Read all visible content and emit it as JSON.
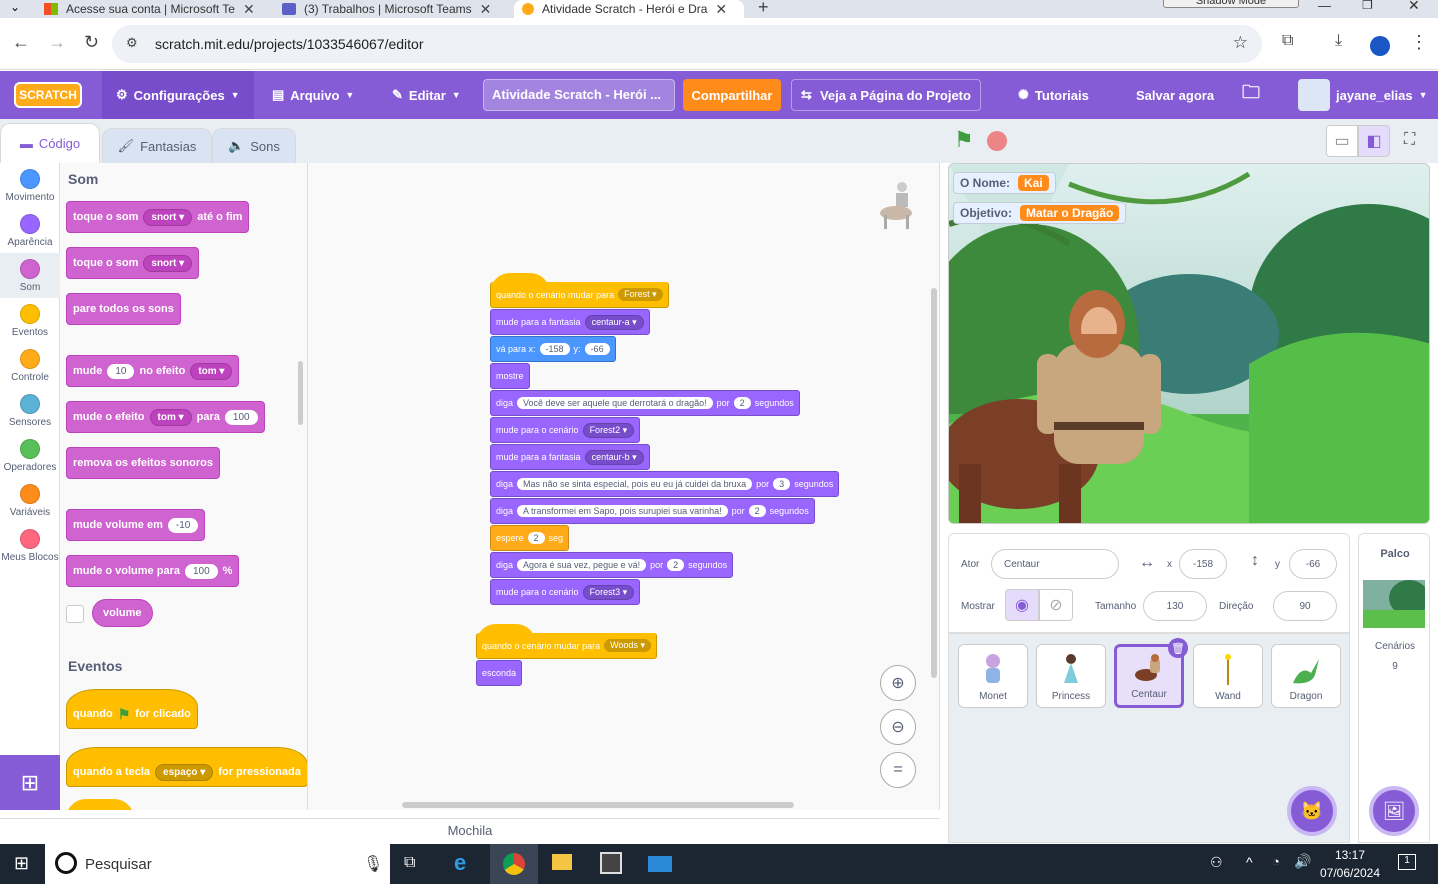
{
  "browser": {
    "tabs": [
      {
        "label": "Acesse sua conta | Microsoft Te"
      },
      {
        "label": "(3) Trabalhos | Microsoft Teams"
      },
      {
        "label": "Atividade Scratch - Herói e Dra"
      }
    ],
    "shadow_mode": "Shadow Mode",
    "url": "scratch.mit.edu/projects/1033546067/editor"
  },
  "menu": {
    "logo": "SCRATCH",
    "settings": "Configurações",
    "file": "Arquivo",
    "edit": "Editar",
    "project_title": "Atividade Scratch - Herói ...",
    "share": "Compartilhar",
    "project_page": "Veja a Página do Projeto",
    "tutorials": "Tutoriais",
    "save_now": "Salvar agora",
    "username": "jayane_elias"
  },
  "editor_tabs": {
    "code": "Código",
    "costumes": "Fantasias",
    "sounds": "Sons"
  },
  "categories": [
    {
      "label": "Movimento",
      "color": "#4c97ff"
    },
    {
      "label": "Aparência",
      "color": "#9966ff"
    },
    {
      "label": "Som",
      "color": "#cf63cf"
    },
    {
      "label": "Eventos",
      "color": "#ffbf00"
    },
    {
      "label": "Controle",
      "color": "#ffab19"
    },
    {
      "label": "Sensores",
      "color": "#5cb1d6"
    },
    {
      "label": "Operadores",
      "color": "#59c059"
    },
    {
      "label": "Variáveis",
      "color": "#ff8c1a"
    },
    {
      "label": "Meus Blocos",
      "color": "#ff6680"
    }
  ],
  "palette": {
    "sound_heading": "Som",
    "play_until_done": {
      "a": "toque o som",
      "dd": "snort",
      "b": "até o fim"
    },
    "start_sound": {
      "a": "toque o som",
      "dd": "snort"
    },
    "stop_all": "pare todos os sons",
    "change_effect": {
      "a": "mude",
      "val": "10",
      "b": "no efeito",
      "dd": "tom"
    },
    "set_effect": {
      "a": "mude o efeito",
      "dd": "tom",
      "b": "para",
      "val": "100"
    },
    "clear_effects": "remova os efeitos sonoros",
    "change_volume": {
      "a": "mude volume em",
      "val": "-10"
    },
    "set_volume": {
      "a": "mude o volume para",
      "val": "100",
      "b": "%"
    },
    "volume": "volume",
    "events_heading": "Eventos",
    "when_flag": {
      "a": "quando",
      "b": "for clicado"
    },
    "when_key": {
      "a": "quando a tecla",
      "dd": "espaço",
      "b": "for pressionada"
    }
  },
  "script1": {
    "hat": {
      "a": "quando o cenário mudar para",
      "dd": "Forest"
    },
    "b1": {
      "a": "mude para a fantasia",
      "dd": "centaur-a"
    },
    "b2": {
      "a": "vá para x:",
      "x": "-158",
      "b": "y:",
      "y": "-66"
    },
    "b3": "mostre",
    "b4": {
      "a": "diga",
      "text": "Você deve ser aquele que derrotará o dragão!",
      "b": "por",
      "n": "2",
      "c": "segundos"
    },
    "b5": {
      "a": "mude para o cenário",
      "dd": "Forest2"
    },
    "b6": {
      "a": "mude para a fantasia",
      "dd": "centaur-b"
    },
    "b7": {
      "a": "diga",
      "text": "Mas não se sinta especial, pois eu eu já cuidei da bruxa",
      "b": "por",
      "n": "3",
      "c": "segundos"
    },
    "b8": {
      "a": "diga",
      "text": "A transformei em Sapo, pois surupiei sua varinha!",
      "b": "por",
      "n": "2",
      "c": "segundos"
    },
    "b9": {
      "a": "espere",
      "n": "2",
      "b": "seg"
    },
    "b10": {
      "a": "diga",
      "text": "Agora é sua vez, pegue e vá!",
      "b": "por",
      "n": "2",
      "c": "segundos"
    },
    "b11": {
      "a": "mude para o cenário",
      "dd": "Forest3"
    }
  },
  "script2": {
    "hat": {
      "a": "quando o cenário mudar para",
      "dd": "Woods"
    },
    "b1": "esconda"
  },
  "backpack": "Mochila",
  "stage": {
    "monitor1": {
      "label": "O Nome:",
      "value": "Kai"
    },
    "monitor2": {
      "label": "Objetivo:",
      "value": "Matar o Dragão"
    }
  },
  "sprite_info": {
    "sprite_label": "Ator",
    "sprite_name": "Centaur",
    "x_label": "x",
    "x": "-158",
    "y_label": "y",
    "y": "-66",
    "show_label": "Mostrar",
    "size_label": "Tamanho",
    "size": "130",
    "direction_label": "Direção",
    "direction": "90"
  },
  "sprites": [
    {
      "name": "Monet"
    },
    {
      "name": "Princess"
    },
    {
      "name": "Centaur"
    },
    {
      "name": "Wand"
    },
    {
      "name": "Dragon"
    }
  ],
  "stage_panel": {
    "title": "Palco",
    "backdrops_label": "Cenários",
    "backdrops_count": "9"
  },
  "taskbar": {
    "search": "Pesquisar",
    "time": "13:17",
    "date": "07/06/2024",
    "notif": "1"
  }
}
